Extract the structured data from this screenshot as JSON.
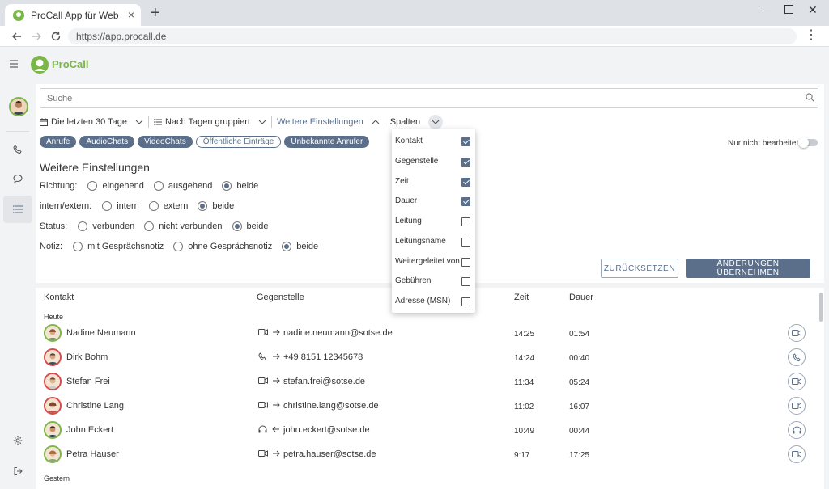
{
  "browser": {
    "tab_title": "ProCall App für Web",
    "url": "https://app.procall.de"
  },
  "app": {
    "brand": "ProCall"
  },
  "search": {
    "placeholder": "Suche"
  },
  "filters": {
    "period": "Die letzten 30 Tage",
    "grouping": "Nach Tagen gruppiert",
    "more_settings": "Weitere Einstellungen",
    "columns": "Spalten"
  },
  "chips": [
    "Anrufe",
    "AudioChats",
    "VideoChats",
    "Öffentliche Einträge",
    "Unbekannte Anrufer"
  ],
  "toggle": {
    "label": "Nur nicht bearbeitete",
    "on": false
  },
  "settings": {
    "title": "Weitere Einstellungen",
    "rows": [
      {
        "label": "Richtung:",
        "options": [
          "eingehend",
          "ausgehend",
          "beide"
        ],
        "selected": 2
      },
      {
        "label": "intern/extern:",
        "options": [
          "intern",
          "extern",
          "beide"
        ],
        "selected": 2
      },
      {
        "label": "Status:",
        "options": [
          "verbunden",
          "nicht verbunden",
          "beide"
        ],
        "selected": 2
      },
      {
        "label": "Notiz:",
        "options": [
          "mit Gesprächsnotiz",
          "ohne Gesprächsnotiz",
          "beide"
        ],
        "selected": 2
      }
    ],
    "reset_label": "ZURÜCKSETZEN",
    "apply_label": "ÄNDERUNGEN ÜBERNEHMEN"
  },
  "columns_menu": [
    {
      "label": "Kontakt",
      "checked": true
    },
    {
      "label": "Gegenstelle",
      "checked": true
    },
    {
      "label": "Zeit",
      "checked": true
    },
    {
      "label": "Dauer",
      "checked": true
    },
    {
      "label": "Leitung",
      "checked": false
    },
    {
      "label": "Leitungsname",
      "checked": false
    },
    {
      "label": "Weitergeleitet von",
      "checked": false
    },
    {
      "label": "Gebühren",
      "checked": false
    },
    {
      "label": "Adresse (MSN)",
      "checked": false
    }
  ],
  "table": {
    "headers": {
      "contact": "Kontakt",
      "remote": "Gegenstelle",
      "time": "Zeit",
      "duration": "Dauer"
    },
    "group_today": "Heute",
    "group_yesterday": "Gestern",
    "rows": [
      {
        "name": "Nadine Neumann",
        "type": "video-icon",
        "direction": "outgoing",
        "address": "nadine.neumann@sotse.de",
        "time": "14:25",
        "duration": "01:54",
        "avatar_ring": "#7ab648"
      },
      {
        "name": "Dirk Bohm",
        "type": "phone-icon",
        "direction": "outgoing",
        "address": "+49 8151  12345678",
        "time": "14:24",
        "duration": "00:40",
        "avatar_ring": "#d64b4b"
      },
      {
        "name": "Stefan Frei",
        "type": "video-icon",
        "direction": "outgoing",
        "address": "stefan.frei@sotse.de",
        "time": "11:34",
        "duration": "05:24",
        "avatar_ring": "#d64b4b"
      },
      {
        "name": "Christine Lang",
        "type": "video-icon",
        "direction": "outgoing",
        "address": "christine.lang@sotse.de",
        "time": "11:02",
        "duration": "16:07",
        "avatar_ring": "#d64b4b"
      },
      {
        "name": "John Eckert",
        "type": "headset-icon",
        "direction": "incoming",
        "address": "john.eckert@sotse.de",
        "time": "10:49",
        "duration": "00:44",
        "avatar_ring": "#7ab648"
      },
      {
        "name": "Petra Hauser",
        "type": "video-icon",
        "direction": "outgoing",
        "address": "petra.hauser@sotse.de",
        "time": "9:17",
        "duration": "17:25",
        "avatar_ring": "#7ab648"
      }
    ]
  },
  "colors": {
    "accent": "#5b6f8a",
    "brand": "#7ab648",
    "avatar_red": "#d64b4b"
  }
}
